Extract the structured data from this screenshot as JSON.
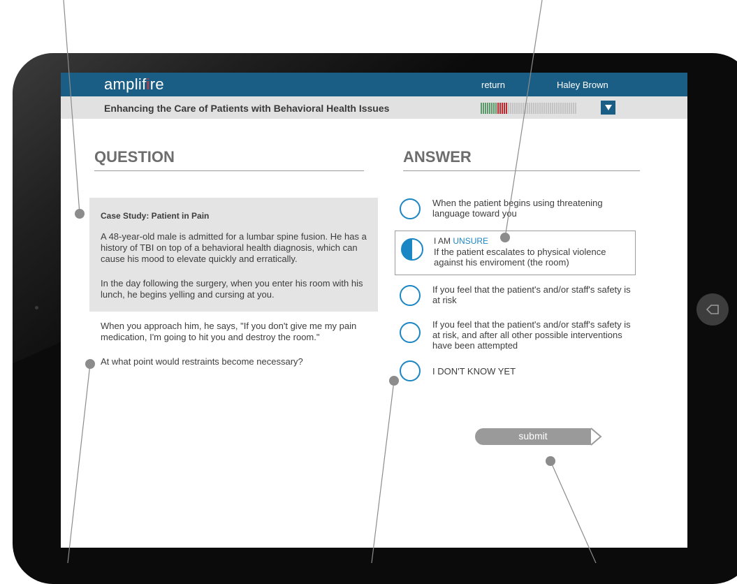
{
  "header": {
    "logo": "amplifire",
    "logo_parts": [
      "amplif",
      "i",
      "re"
    ],
    "return_link": "return",
    "user_name": "Haley Brown"
  },
  "subheader": {
    "course_title": "Enhancing the Care of Patients with Behavioral Health Issues",
    "progress_segments": {
      "green": 8,
      "red": 5,
      "gray": 33
    }
  },
  "question": {
    "heading": "QUESTION",
    "case_title": "Case Study: Patient in Pain",
    "case_paragraphs": [
      "A 48-year-old male is admitted for a lumbar spine fusion. He has a history of TBI on top of a behavioral health diagnosis, which can cause his mood to elevate quickly and erratically.",
      "In the day following the surgery, when you enter his room with his lunch, he begins yelling and cursing at you."
    ],
    "quote": "When you approach him, he says, \"If you don't give me my pain medication, I'm going to hit you and destroy the room.\"",
    "prompt": "At what point would restraints become necessary?"
  },
  "answer": {
    "heading": "ANSWER",
    "options": [
      "When the patient begins using threatening language toward you",
      "If the patient escalates to physical violence against his enviroment (the room)",
      "If you feel that the patient's and/or staff's safety is at risk",
      "If you feel that the patient's and/or staff's safety is at risk, and after all other possible interventions have been attempted",
      "I DON'T KNOW YET"
    ],
    "selected_prefix": "I AM",
    "selected_confidence": "UNSURE",
    "submit_label": "submit"
  },
  "colors": {
    "brand_blue": "#1b5e85",
    "accent_blue": "#1b86c4",
    "logo_red": "#e0322f",
    "progress_green": "#5c9a6a",
    "progress_red": "#c0282d"
  },
  "icons": [
    "back-arrow-icon",
    "chevron-down-icon",
    "chevron-right-icon"
  ]
}
